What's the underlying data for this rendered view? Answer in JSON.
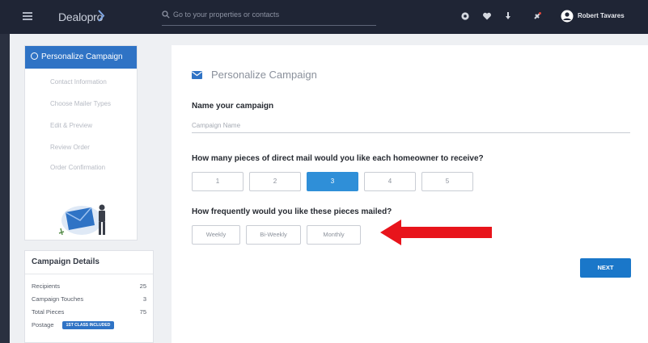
{
  "colors": {
    "topbar": "#1f2535",
    "accent": "#2f73c5",
    "selected_option": "#2f8fd8",
    "next_button": "#1a77c9",
    "annotation_arrow": "#e8141b"
  },
  "topbar": {
    "logo_text": "Dealopro",
    "search_placeholder": "Go to your properties or contacts",
    "icons": [
      "settings-icon",
      "heart-icon",
      "download-icon",
      "notification-icon"
    ],
    "user_name": "Robert Tavares"
  },
  "stepper": {
    "active_step": "Personalize Campaign",
    "steps": [
      "Contact Information",
      "Choose Mailer Types",
      "Edit & Preview",
      "Review Order",
      "Order Confirmation"
    ]
  },
  "details": {
    "title": "Campaign Details",
    "rows": [
      {
        "label": "Recipients",
        "value": "25"
      },
      {
        "label": "Campaign Touches",
        "value": "3"
      },
      {
        "label": "Total Pieces",
        "value": "75"
      }
    ],
    "postage_label": "Postage",
    "postage_badge": "1ST CLASS INCLUDED"
  },
  "main": {
    "title": "Personalize Campaign",
    "name_label": "Name your campaign",
    "name_placeholder": "Campaign Name",
    "pieces_question": "How many pieces of direct mail would you like each homeowner to receive?",
    "piece_options": [
      "1",
      "2",
      "3",
      "4",
      "5"
    ],
    "selected_piece": "3",
    "frequency_question": "How frequently would you like these pieces mailed?",
    "frequency_options": [
      "Weekly",
      "Bi-Weekly",
      "Monthly"
    ],
    "next_label": "NEXT"
  }
}
